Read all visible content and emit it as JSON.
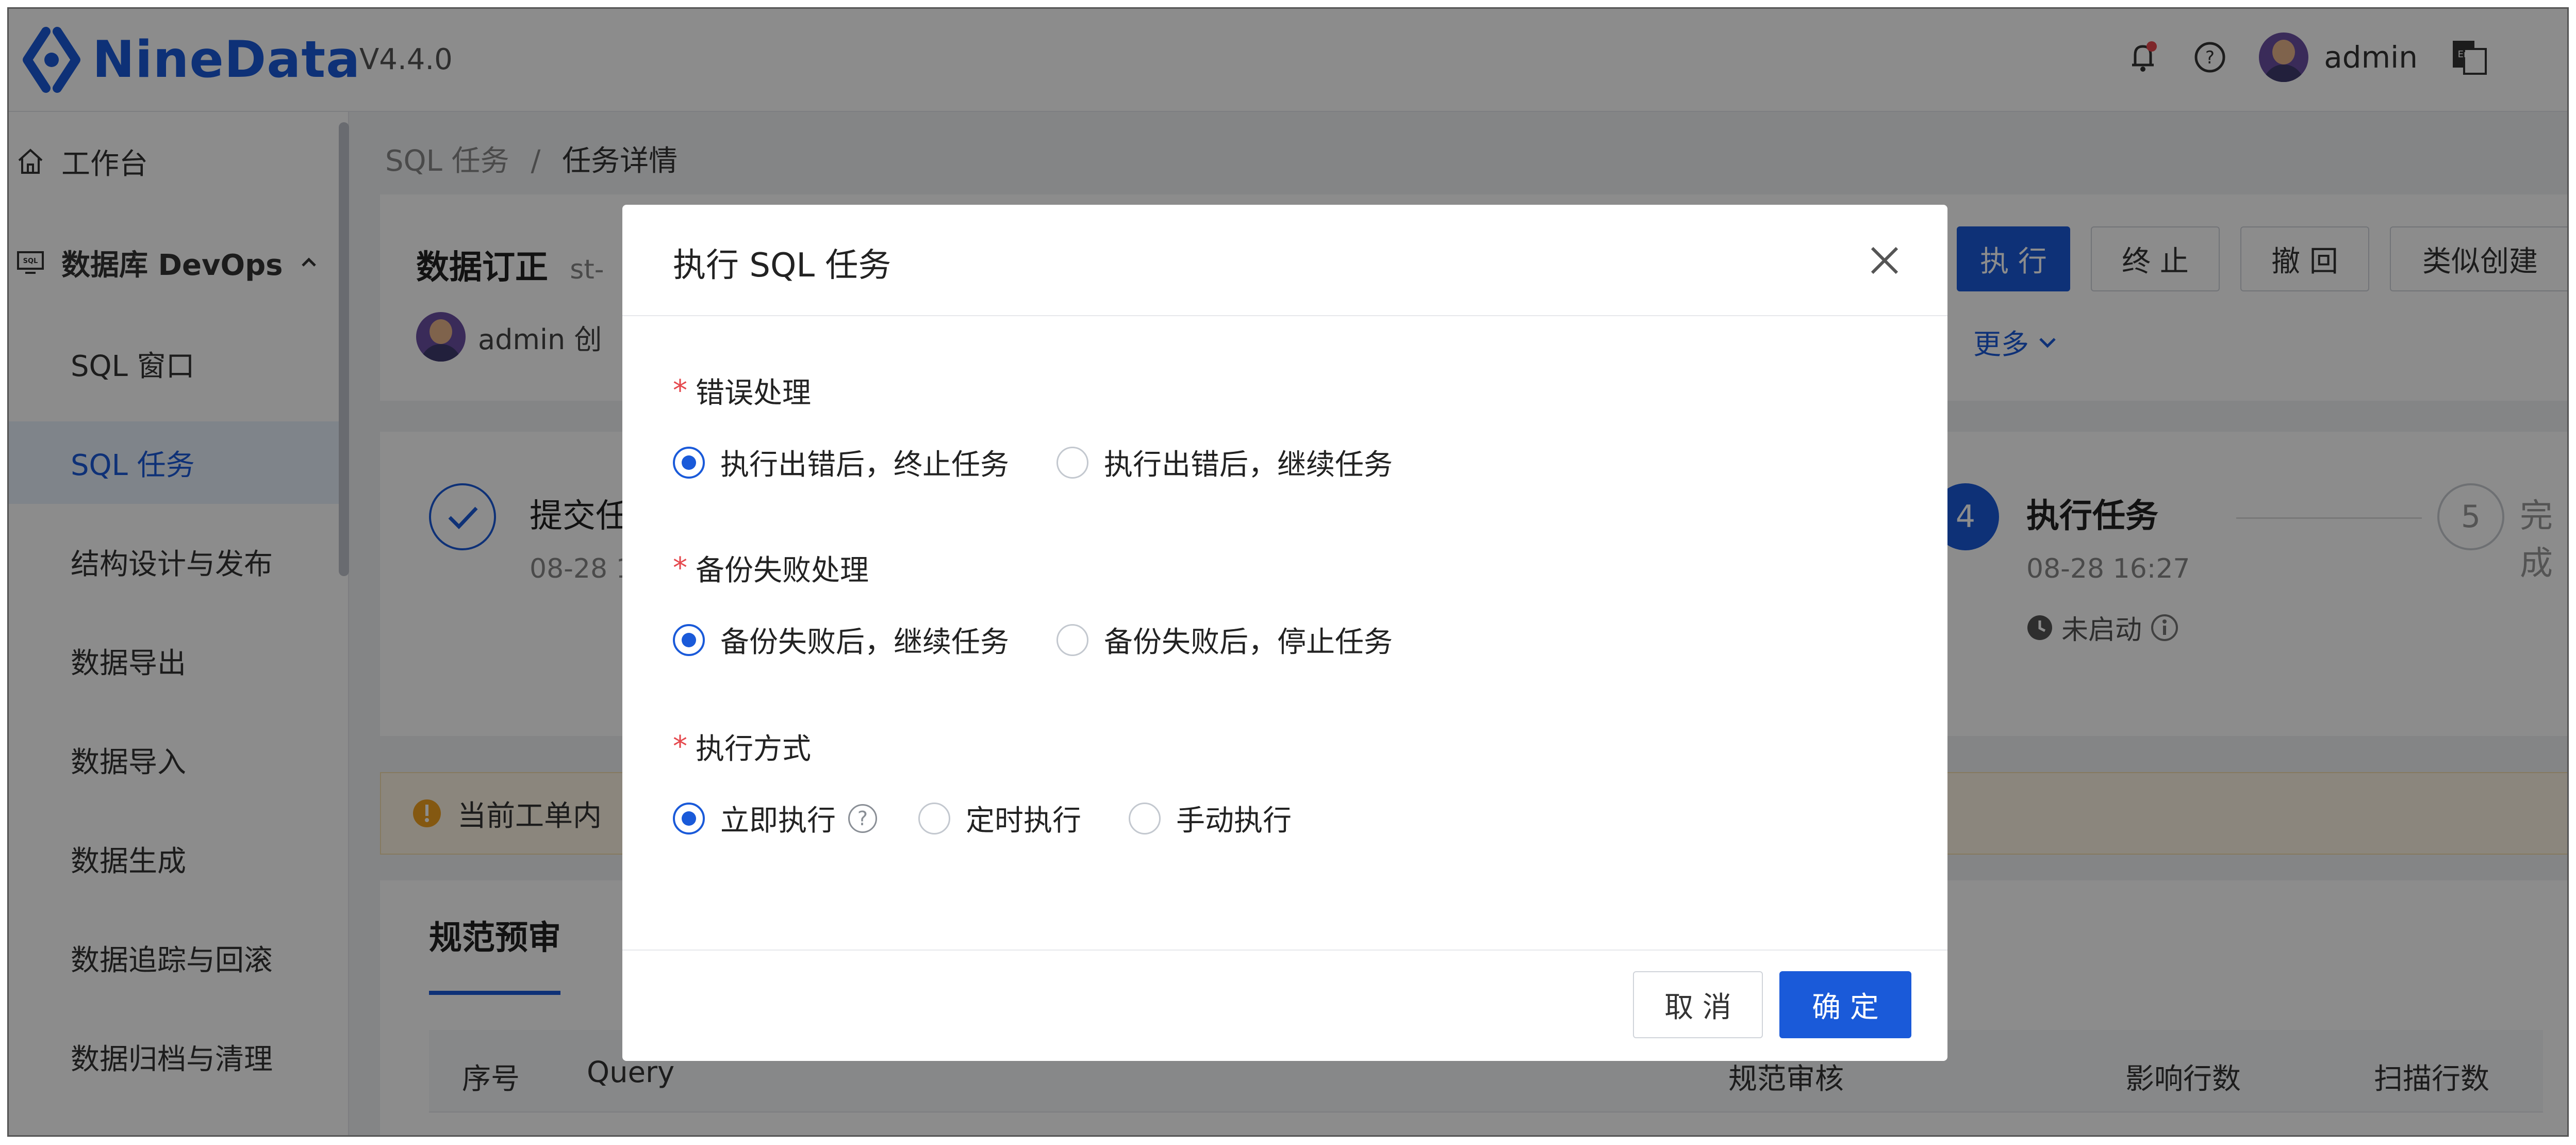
{
  "app": {
    "brand": "NineData",
    "version": "V4.4.0",
    "user": "admin"
  },
  "sidebar": {
    "items": [
      {
        "label": "工作台"
      },
      {
        "label": "数据库 DevOps"
      },
      {
        "label": "SQL 窗口"
      },
      {
        "label": "SQL 任务"
      },
      {
        "label": "结构设计与发布"
      },
      {
        "label": "数据导出"
      },
      {
        "label": "数据导入"
      },
      {
        "label": "数据生成"
      },
      {
        "label": "数据追踪与回滚"
      },
      {
        "label": "数据归档与清理"
      }
    ]
  },
  "breadcrumb": {
    "parent": "SQL 任务",
    "separator": "/",
    "current": "任务详情"
  },
  "task": {
    "title": "数据订正",
    "id_prefix": "st-",
    "creator": "admin 创",
    "more": "更多",
    "actions": {
      "execute": "执 行",
      "stop": "终 止",
      "revoke": "撤 回",
      "clone": "类似创建"
    }
  },
  "steps": {
    "first_label": "提交任",
    "first_time": "08-28 1",
    "step4_num": "4",
    "step4_label": "执行任务",
    "step4_time": "08-28 16:27",
    "step4_status": "未启动",
    "step5_num": "5",
    "step5_label": "完成"
  },
  "notice": {
    "text": "当前工单内"
  },
  "review": {
    "tab": "规范预审",
    "columns": {
      "index": "序号",
      "query": "Query",
      "audit": "规范审核",
      "affected": "影响行数",
      "scanned": "扫描行数"
    }
  },
  "modal": {
    "title": "执行 SQL 任务",
    "error_handling": {
      "label": "错误处理",
      "options": [
        "执行出错后，终止任务",
        "执行出错后，继续任务"
      ],
      "selected": 0
    },
    "backup_failure": {
      "label": "备份失败处理",
      "options": [
        "备份失败后，继续任务",
        "备份失败后，停止任务"
      ],
      "selected": 0
    },
    "exec_mode": {
      "label": "执行方式",
      "options": [
        "立即执行",
        "定时执行",
        "手动执行"
      ],
      "selected": 0
    },
    "cancel": "取 消",
    "confirm": "确 定"
  },
  "colors": {
    "primary": "#1a5ad9",
    "required": "#e5484d",
    "warning": "#f0a020"
  }
}
